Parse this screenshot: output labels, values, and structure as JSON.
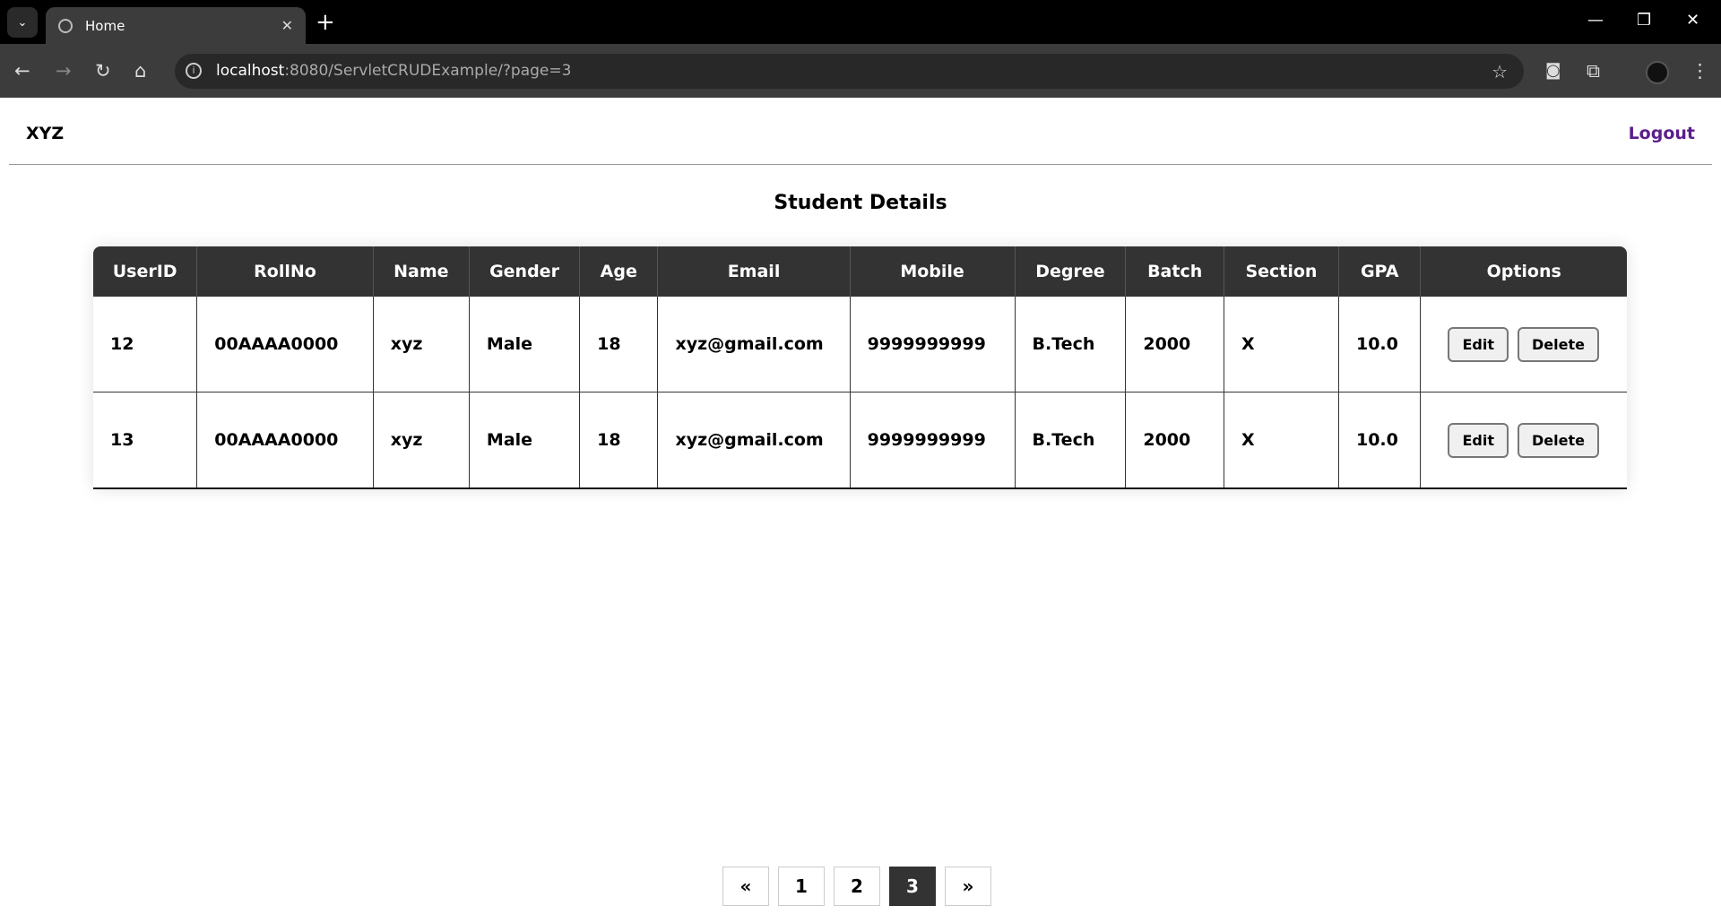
{
  "browser": {
    "tab_title": "Home",
    "url_host": "localhost",
    "url_rest": ":8080/ServletCRUDExample/?page=3"
  },
  "navbar": {
    "brand": "XYZ",
    "logout": "Logout"
  },
  "page_title": "Student Details",
  "table": {
    "headers": [
      "UserID",
      "RollNo",
      "Name",
      "Gender",
      "Age",
      "Email",
      "Mobile",
      "Degree",
      "Batch",
      "Section",
      "GPA",
      "Options"
    ],
    "rows": [
      [
        "12",
        "00AAAA0000",
        "xyz",
        "Male",
        "18",
        "xyz@gmail.com",
        "9999999999",
        "B.Tech",
        "2000",
        "X",
        "10.0"
      ],
      [
        "13",
        "00AAAA0000",
        "xyz",
        "Male",
        "18",
        "xyz@gmail.com",
        "9999999999",
        "B.Tech",
        "2000",
        "X",
        "10.0"
      ]
    ],
    "edit_label": "Edit",
    "delete_label": "Delete"
  },
  "pagination": {
    "prev": "«",
    "pages": [
      "1",
      "2",
      "3"
    ],
    "active_page": "3",
    "next": "»"
  },
  "colors": {
    "header_bg": "#333333",
    "logout": "#5b1e8c"
  }
}
